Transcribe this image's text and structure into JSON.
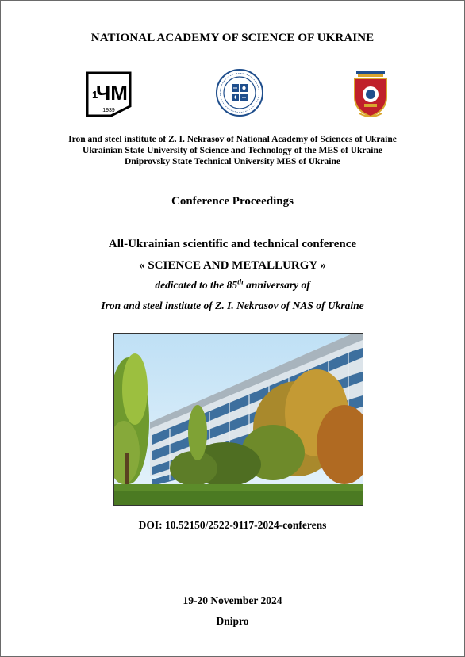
{
  "header": {
    "academy": "NATIONAL ACADEMY OF SCIENCE OF UKRAINE"
  },
  "logos": {
    "left_text": "ЧМ",
    "left_year": "1939",
    "left_icon": "ichm-institute-logo",
    "center_icon": "ustu-university-seal",
    "right_icon": "dstu-university-crest"
  },
  "institutions": [
    "Iron and steel institute of Z. I. Nekrasov of National Academy of Sciences of Ukraine",
    "Ukrainian State University of Science and Technology of the MES of Ukraine",
    "Dniprovsky State Technical University MES of Ukraine"
  ],
  "proceedings": "Conference Proceedings",
  "conference": {
    "type": "All-Ukrainian scientific and technical conference",
    "name": "« SCIENCE AND METALLURGY »",
    "dedication_pre": "dedicated to the 85",
    "dedication_sup": "th",
    "dedication_post": " anniversary of",
    "institute": "Iron and steel institute of Z. I. Nekrasov of NAS of Ukraine"
  },
  "doi": "DOI: 10.52150/2522-9117-2024-conferens",
  "date": "19-20 November 2024",
  "city": "Dnipro",
  "colors": {
    "border": "#6a6a6a",
    "logo_blue": "#1f4e8c",
    "crest_red": "#c0202a",
    "crest_gold": "#d9a62e"
  }
}
